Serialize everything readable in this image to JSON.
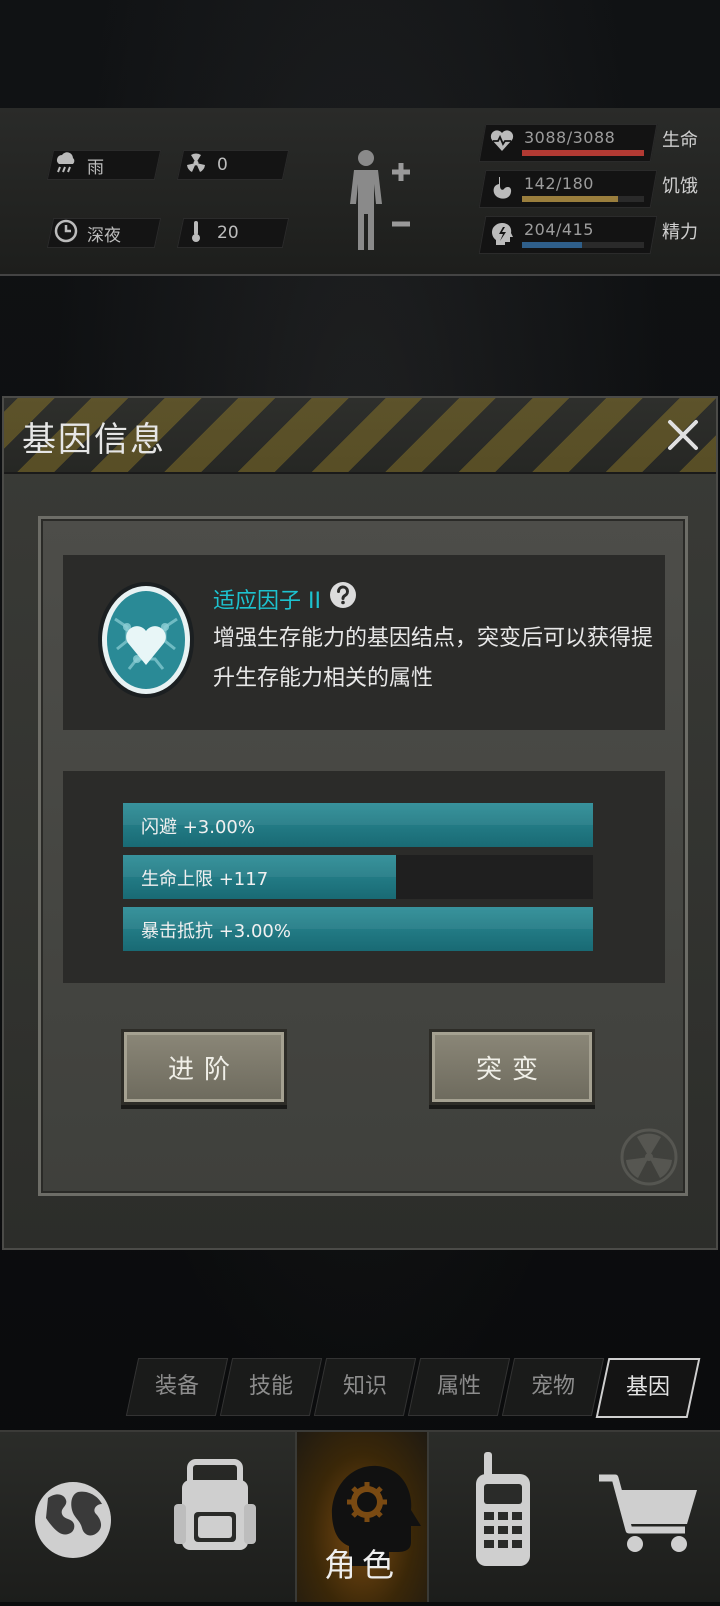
{
  "status": {
    "weather": {
      "icon": "rain-cloud-icon",
      "text": "雨"
    },
    "radiation": {
      "icon": "radiation-icon",
      "text": "0"
    },
    "time": {
      "icon": "clock-icon",
      "text": "深夜"
    },
    "temperature": {
      "icon": "thermometer-icon",
      "text": "20"
    }
  },
  "vitals": [
    {
      "icon": "heartbeat-icon",
      "value": "3088/3088",
      "label": "生命",
      "fraction": 1.0,
      "color": "#b23a33"
    },
    {
      "icon": "stomach-icon",
      "value": "142/180",
      "label": "饥饿",
      "fraction": 0.79,
      "color": "#9a7e3d"
    },
    {
      "icon": "energy-head-icon",
      "value": "204/415",
      "label": "精力",
      "fraction": 0.49,
      "color": "#2f5f8a"
    }
  ],
  "dialog": {
    "title": "基因信息",
    "gene_name": "适应因子 II",
    "gene_desc": "增强生存能力的基因结点，突变后可以获得提升生存能力相关的属性",
    "stats": [
      {
        "text": "闪避 +3.00%",
        "fraction": 1.0
      },
      {
        "text": "生命上限 +117",
        "fraction": 0.58
      },
      {
        "text": "暴击抵抗 +3.00%",
        "fraction": 1.0
      }
    ],
    "buttons": {
      "advance": "进阶",
      "mutate": "突变"
    }
  },
  "tabs": [
    {
      "label": "装备",
      "active": false
    },
    {
      "label": "技能",
      "active": false
    },
    {
      "label": "知识",
      "active": false
    },
    {
      "label": "属性",
      "active": false
    },
    {
      "label": "宠物",
      "active": false
    },
    {
      "label": "基因",
      "active": true
    }
  ],
  "bottom_nav": {
    "world": "globe-icon",
    "backpack": "backpack-icon",
    "character": {
      "icon": "head-gear-icon",
      "label": "角色"
    },
    "radio": "walkie-talkie-icon",
    "shop": "shopping-cart-icon"
  },
  "colors": {
    "accent": "#1dc2cf",
    "stat_bar": "#2c8c96",
    "active_nav": "#7a4a12"
  }
}
